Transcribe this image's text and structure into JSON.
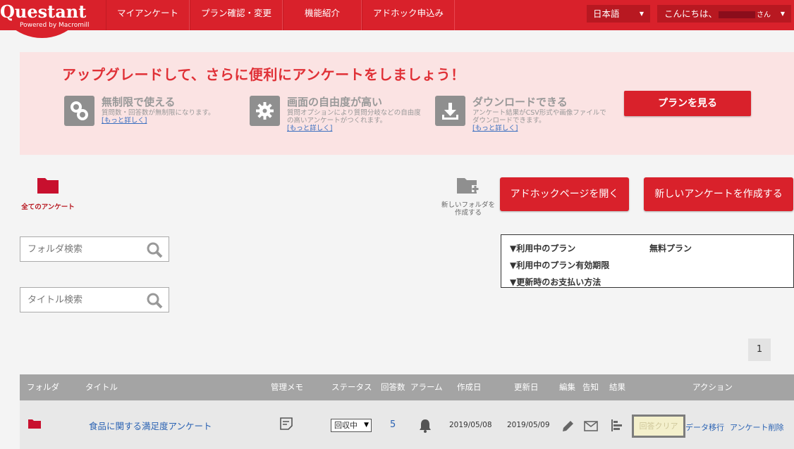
{
  "header": {
    "logo": "Questant",
    "logo_sub": "Powered by Macromill",
    "nav": [
      "マイアンケート",
      "プラン確認・変更",
      "機能紹介",
      "アドホック申込み"
    ],
    "language": "日本語",
    "greeting_prefix": "こんにちは、",
    "greeting_suffix": "さん"
  },
  "promo": {
    "title": "アップグレードして、さらに便利にアンケートをしましょう！",
    "features": [
      {
        "title": "無制限で使える",
        "desc": "質問数・回答数が無制限になります。",
        "link": "[もっと詳しく]",
        "icon": "link-icon"
      },
      {
        "title": "画面の自由度が高い",
        "desc": "質問オプションにより質問分岐などの自由度の高いアンケートがつくれます。",
        "link": "[もっと詳しく]",
        "icon": "gear-icon"
      },
      {
        "title": "ダウンロードできる",
        "desc": "アンケート結果がCSV形式や画像ファイルでダウンロードできます。",
        "link": "[もっと詳しく]",
        "icon": "download-icon"
      }
    ],
    "cta": "プランを見る"
  },
  "toolbar": {
    "all_surveys": "全てのアンケート",
    "new_folder_line1": "新しいフォルダを",
    "new_folder_line2": "作成する",
    "adhoc_button": "アドホックページを開く",
    "new_survey_button": "新しいアンケートを作成する"
  },
  "search": {
    "folder_placeholder": "フォルダ検索",
    "title_placeholder": "タイトル検索"
  },
  "plan_info": {
    "rows": [
      {
        "key": "▼利用中のプラン",
        "value": "無料プラン"
      },
      {
        "key": "▼利用中のプラン有効期限",
        "value": ""
      },
      {
        "key": "▼更新時のお支払い方法",
        "value": ""
      }
    ]
  },
  "pagination": {
    "current": "1"
  },
  "table": {
    "columns": {
      "folder": "フォルダ",
      "title": "タイトル",
      "memo": "管理メモ",
      "status": "ステータス",
      "responses": "回答数",
      "alarm": "アラーム",
      "created": "作成日",
      "updated": "更新日",
      "edit": "編集",
      "notify": "告知",
      "results": "結果",
      "actions": "アクション"
    },
    "rows": [
      {
        "title": "食品に関する満足度アンケート",
        "status": "回収中",
        "responses": "5",
        "created": "2019/05/08",
        "updated": "2019/05/09",
        "clear": "回答クリア",
        "migrate": "データ移行",
        "delete": "アンケート削除"
      }
    ]
  },
  "colors": {
    "brand_red": "#d9212b",
    "promo_bg": "#fbe3e3",
    "link_blue": "#2a62b3"
  }
}
